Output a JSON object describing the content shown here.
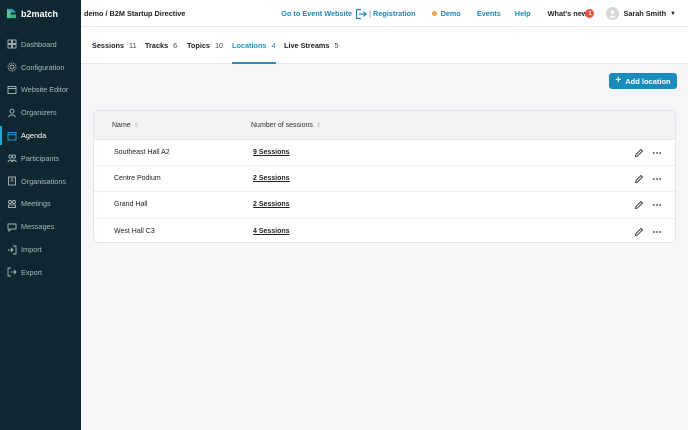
{
  "brand": {
    "name": "b2match"
  },
  "breadcrumb": "demo / B2M Startup Directive",
  "topbar": {
    "goto_label": "Go to Event Website",
    "separator": "|",
    "registration_label": "Registration",
    "demo_label": "Demo",
    "events_label": "Events",
    "help_label": "Help",
    "whats_new_label": "What's new",
    "whats_new_count": "1",
    "user_name": "Sarah Smith"
  },
  "sidebar": {
    "items": [
      {
        "label": "Dashboard",
        "icon": "dashboard-icon"
      },
      {
        "label": "Configuration",
        "icon": "configuration-icon"
      },
      {
        "label": "Website Editor",
        "icon": "website-editor-icon"
      },
      {
        "label": "Organizers",
        "icon": "organizers-icon"
      },
      {
        "label": "Agenda",
        "icon": "agenda-icon",
        "active": true
      },
      {
        "label": "Participants",
        "icon": "participants-icon"
      },
      {
        "label": "Organisations",
        "icon": "organisations-icon"
      },
      {
        "label": "Meetings",
        "icon": "meetings-icon"
      },
      {
        "label": "Messages",
        "icon": "messages-icon"
      },
      {
        "label": "Import",
        "icon": "import-icon"
      },
      {
        "label": "Export",
        "icon": "export-icon"
      }
    ]
  },
  "tabs": [
    {
      "label": "Sessions",
      "count": "11"
    },
    {
      "label": "Tracks",
      "count": "6"
    },
    {
      "label": "Topics",
      "count": "10"
    },
    {
      "label": "Locations",
      "count": "4",
      "active": true
    },
    {
      "label": "Live Streams",
      "count": "5"
    }
  ],
  "add_button": {
    "label": "Add location"
  },
  "table": {
    "columns": {
      "name": "Name",
      "sessions": "Number of sessions"
    },
    "rows": [
      {
        "name": "Southeast Hall A2",
        "sessions": "9 Sessions"
      },
      {
        "name": "Centre Podium",
        "sessions": "2 Sessions"
      },
      {
        "name": "Grand Hall",
        "sessions": "2 Sessions"
      },
      {
        "name": "West Hall C3",
        "sessions": "4 Sessions"
      }
    ]
  },
  "colors": {
    "sidebar": "#0f2730",
    "accent": "#1a8bbf",
    "demo_dot": "#f0a33a",
    "badge": "#e9553f"
  }
}
